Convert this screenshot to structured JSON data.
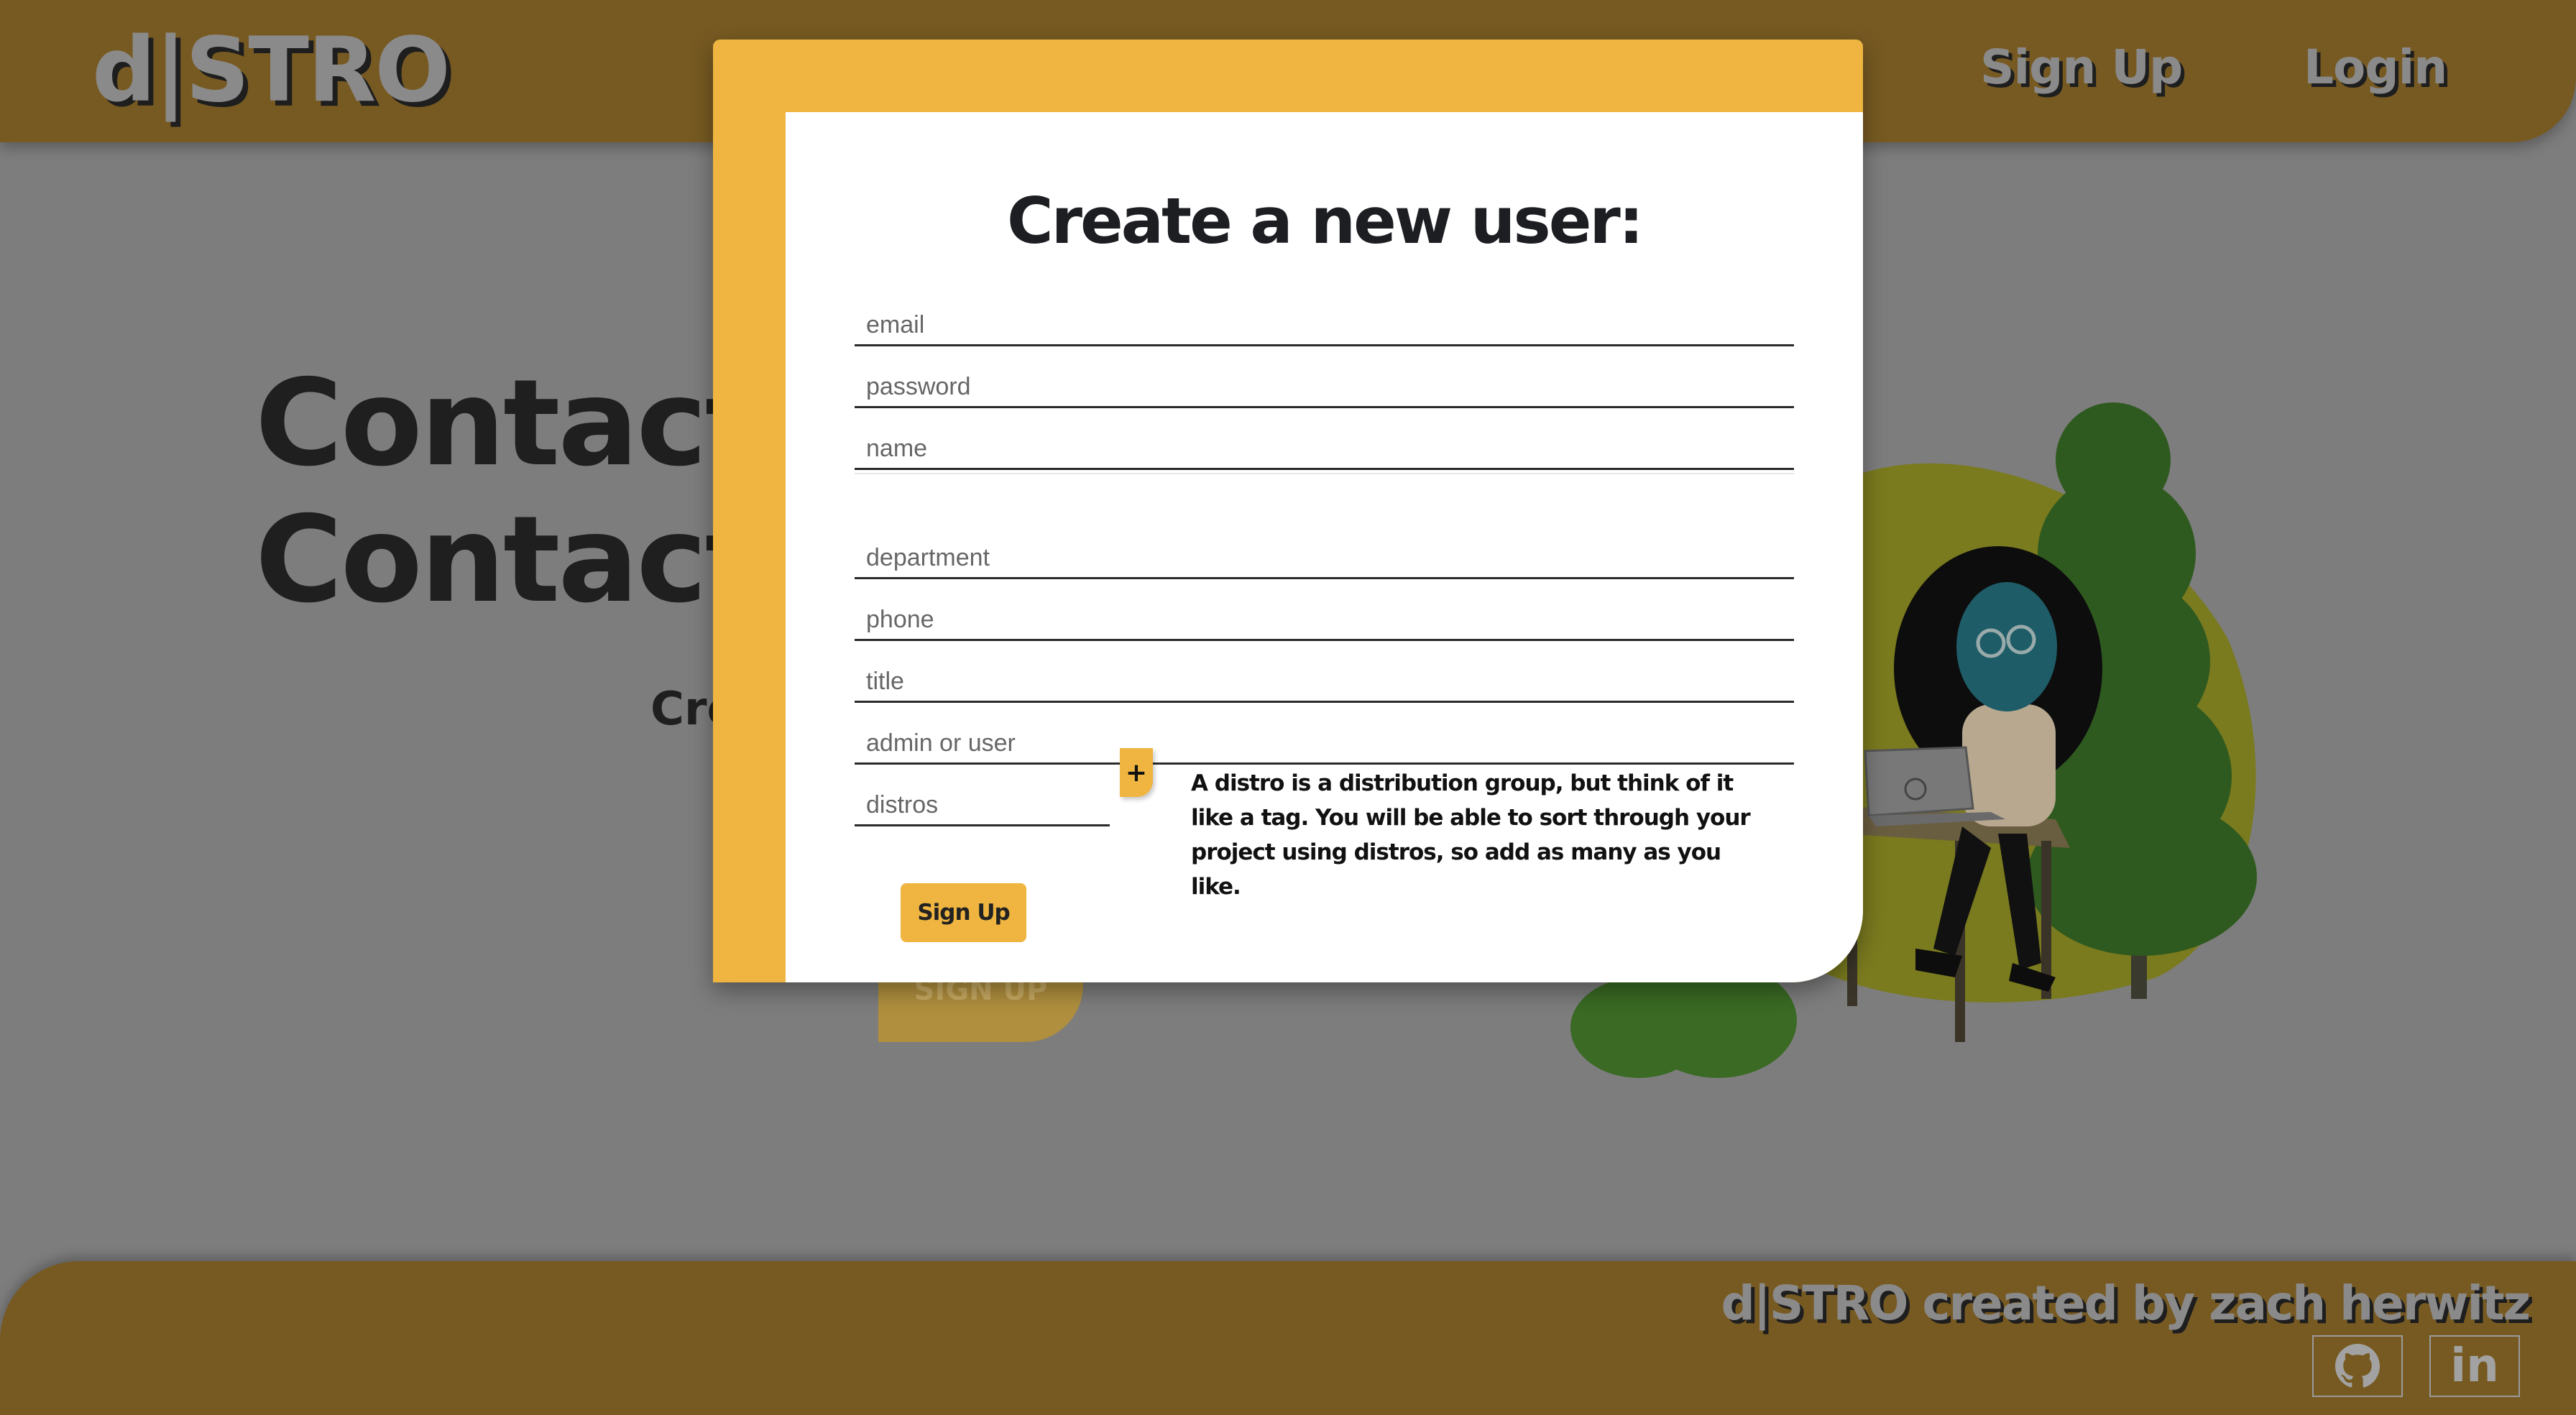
{
  "header": {
    "brand": "d|STRO",
    "nav": {
      "signup": "Sign Up",
      "login": "Login"
    }
  },
  "hero": {
    "title_line1": "Contacts",
    "title_line2": "Contactl",
    "subtitle_partial": "Cre",
    "cta_label": "SIGN UP"
  },
  "modal": {
    "title": "Create a new user:",
    "fields": {
      "email": "email",
      "password": "password",
      "name": "name",
      "department": "department",
      "phone": "phone",
      "title": "title",
      "role": "admin or user",
      "distros": "distros"
    },
    "add_distro_label": "+",
    "distro_note": "A distro is a distribution group, but think of it like a tag. You will be able to sort through your project using distros, so add as many as you like.",
    "submit_label": "Sign Up"
  },
  "footer": {
    "credit": "d|STRO created by zach herwitz",
    "github_icon": "github-icon",
    "linkedin_label": "in"
  },
  "colors": {
    "accent": "#efb540",
    "header_bg": "#775a22",
    "overlay": "#7d7d7d",
    "text_dark": "#1c1e22"
  }
}
